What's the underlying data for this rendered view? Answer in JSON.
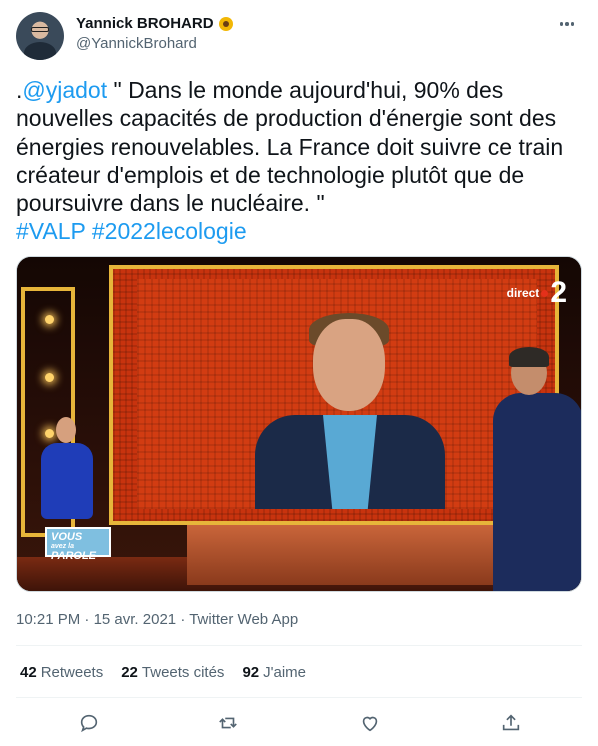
{
  "author": {
    "display_name": "Yannick BROHARD",
    "emoji_icon": "sunflower-icon",
    "handle": "@YannickBrohard"
  },
  "tweet": {
    "prefix": ".",
    "mention": "@yjadot",
    "body": " \" Dans le monde aujourd'hui, 90% des nouvelles capacités de production d'énergie sont des énergies renouvelables. La France doit suivre ce train créateur d'emplois et de technologie plutôt que de poursuivre dans le nucléaire. \"",
    "hashtag1": "#VALP",
    "hashtag2": "#2022lecologie"
  },
  "media": {
    "channel_label": "direct",
    "channel_number": "2",
    "show_badge_line1": "VOUS",
    "show_badge_line2": "avez la",
    "show_badge_line3": "PAROLE"
  },
  "meta": {
    "time": "10:21 PM",
    "sep": "·",
    "date": "15 avr. 2021",
    "source": "Twitter Web App"
  },
  "stats": {
    "retweets_count": "42",
    "retweets_label": "Retweets",
    "quotes_count": "22",
    "quotes_label": "Tweets cités",
    "likes_count": "92",
    "likes_label": "J'aime"
  },
  "actions": [
    "reply-icon",
    "retweet-icon",
    "like-icon",
    "share-icon"
  ],
  "colors": {
    "link": "#1d9bf0",
    "text": "#0f1419",
    "secondary": "#536471"
  }
}
